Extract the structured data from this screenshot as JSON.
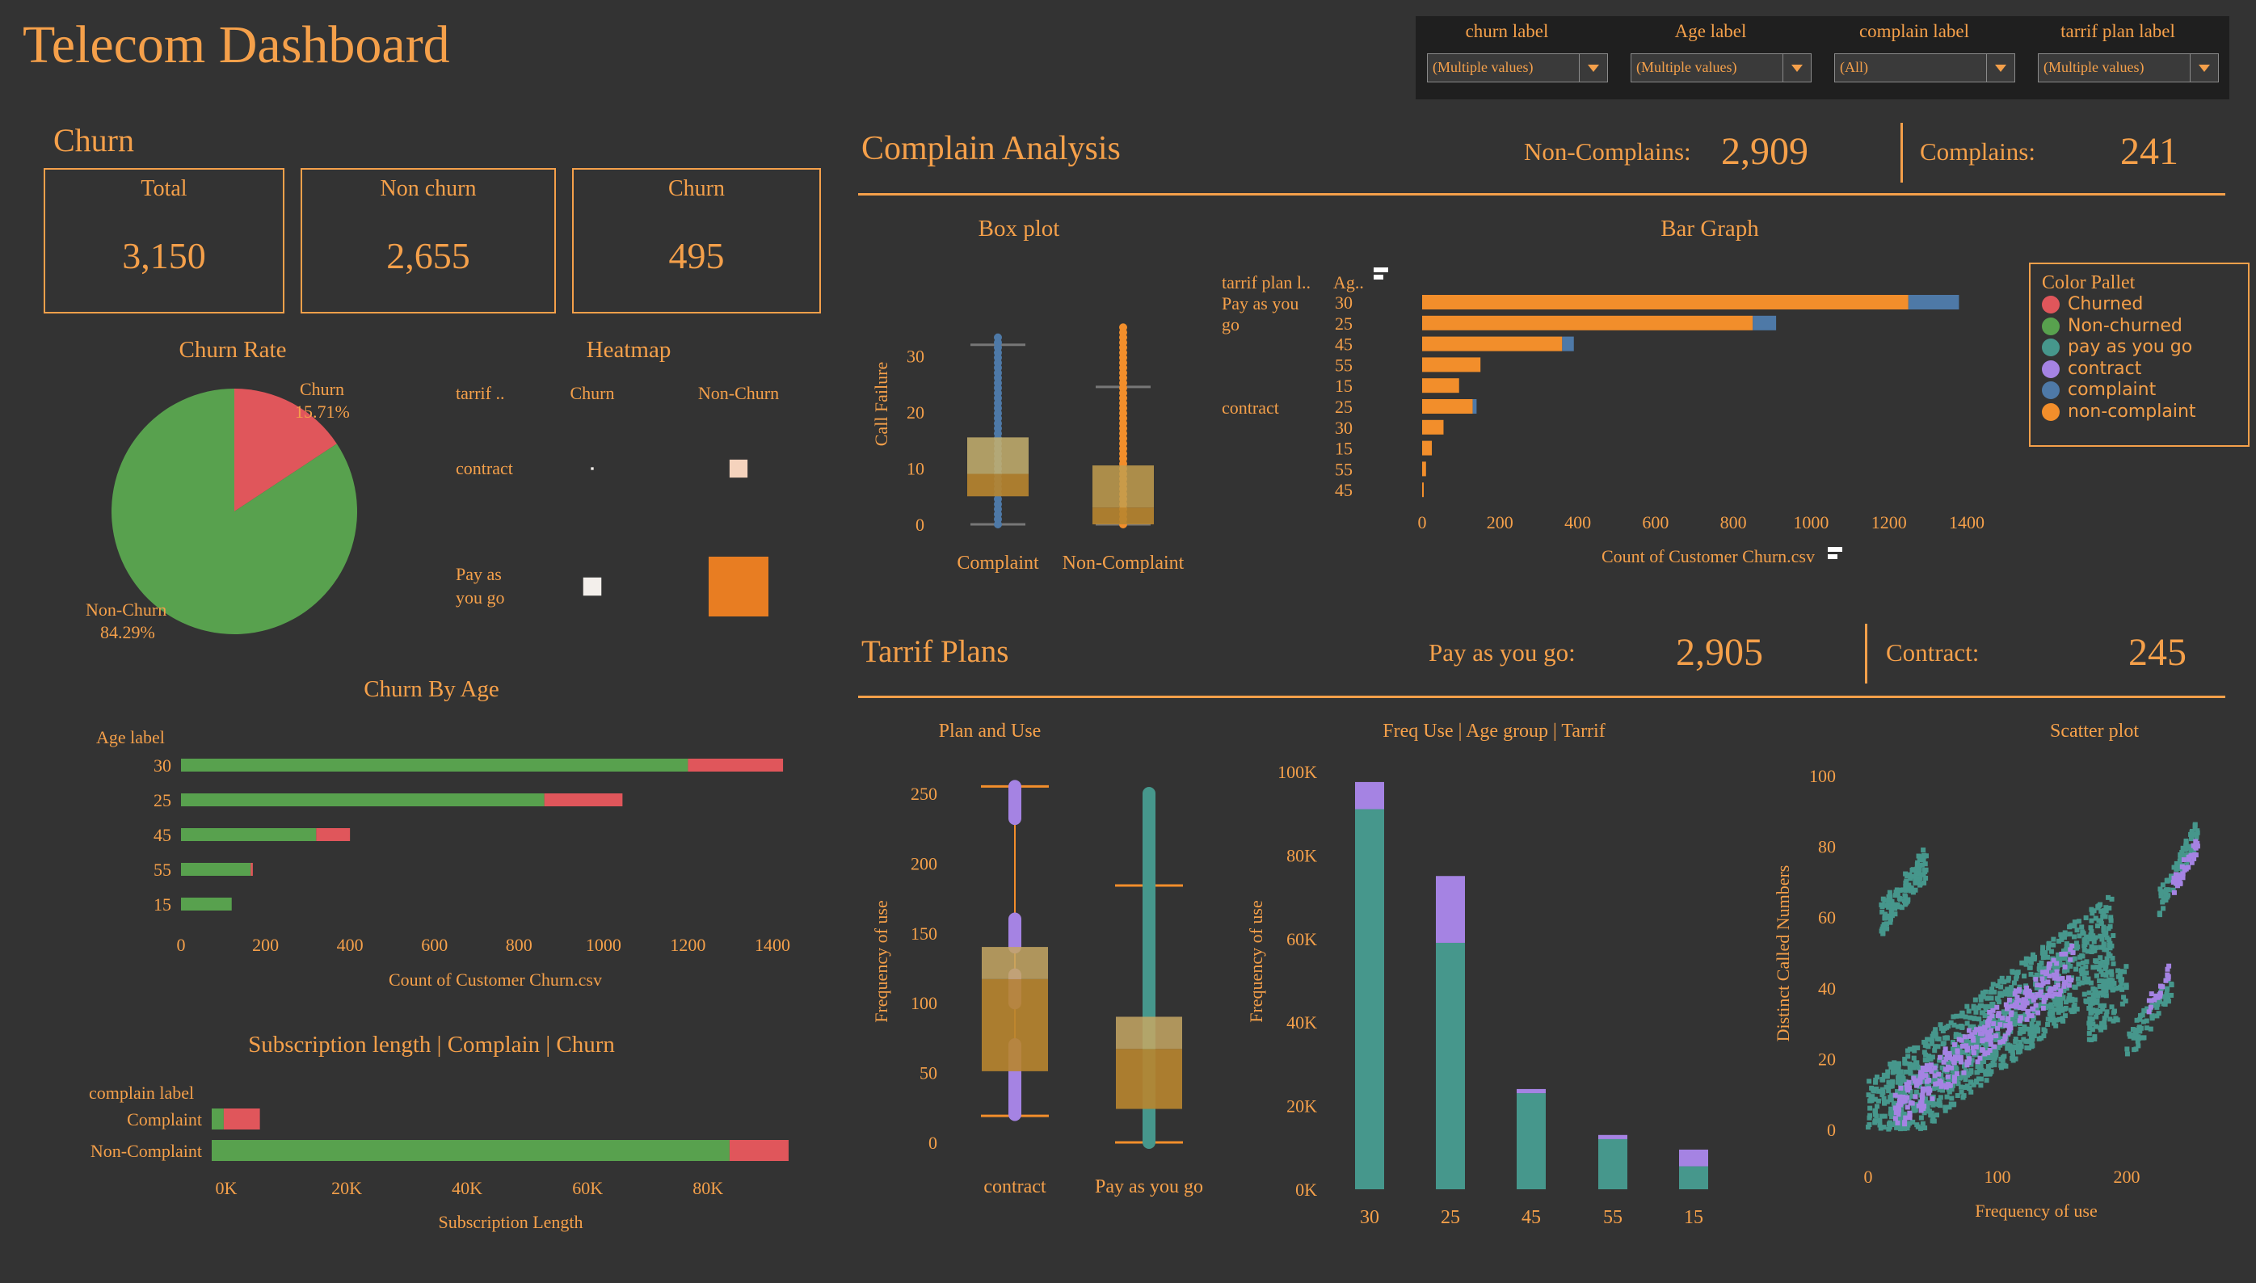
{
  "header": {
    "title": "Telecom Dashboard"
  },
  "filters": [
    {
      "label": "churn label",
      "value": "(Multiple values)"
    },
    {
      "label": "Age label",
      "value": "(Multiple values)"
    },
    {
      "label": "complain label",
      "value": "(All)"
    },
    {
      "label": "tarrif plan label",
      "value": "(Multiple values)"
    }
  ],
  "churn": {
    "title": "Churn",
    "kpis": [
      {
        "label": "Total",
        "value": "3,150"
      },
      {
        "label": "Non churn",
        "value": "2,655"
      },
      {
        "label": "Churn",
        "value": "495"
      }
    ]
  },
  "complain_analysis": {
    "title": "Complain Analysis",
    "non_complains_label": "Non-Complains:",
    "non_complains_value": "2,909",
    "complains_label": "Complains:",
    "complains_value": "241"
  },
  "tarrif_plans": {
    "title": "Tarrif Plans",
    "payg_label": "Pay as you go:",
    "payg_value": "2,905",
    "contract_label": "Contract:",
    "contract_value": "245"
  },
  "color_pallet": {
    "title": "Color Pallet",
    "items": [
      {
        "label": "Churned",
        "color": "#e0565b"
      },
      {
        "label": "Non-churned",
        "color": "#58a14e"
      },
      {
        "label": "pay as you go",
        "color": "#46978c"
      },
      {
        "label": "contract",
        "color": "#a583e3"
      },
      {
        "label": "complaint",
        "color": "#4e79a7"
      },
      {
        "label": "non-complaint",
        "color": "#f28e2b"
      }
    ]
  },
  "colors": {
    "churned": "#e0565b",
    "non_churned": "#58a14e",
    "payg": "#46978c",
    "contract": "#a583e3",
    "complaint": "#4e79a7",
    "non_complaint": "#f28e2b",
    "text": "#f5a04a",
    "background": "#333333"
  },
  "chart_data": [
    {
      "id": "churn-rate",
      "type": "pie",
      "title": "Churn Rate",
      "slices": [
        {
          "name": "Churn",
          "value": 15.71,
          "label": "15.71%",
          "color": "#e0565b"
        },
        {
          "name": "Non-Churn",
          "value": 84.29,
          "label": "84.29%",
          "color": "#58a14e"
        }
      ]
    },
    {
      "id": "heatmap",
      "type": "heatmap",
      "title": "Heatmap",
      "row_header": "tarrif ..",
      "columns": [
        "Churn",
        "Non-Churn"
      ],
      "rows": [
        "contract",
        "Pay as you go"
      ],
      "values": [
        [
          5,
          220
        ],
        [
          225,
          2430
        ]
      ],
      "max": 2430
    },
    {
      "id": "churn-by-age",
      "type": "bar",
      "orientation": "horizontal",
      "stacked": true,
      "title": "Churn By Age",
      "row_header": "Age label",
      "categories": [
        "30",
        "25",
        "45",
        "55",
        "15"
      ],
      "series": [
        {
          "name": "Non-churned",
          "color": "#58a14e",
          "values": [
            1200,
            860,
            320,
            165,
            120
          ]
        },
        {
          "name": "Churned",
          "color": "#e0565b",
          "values": [
            225,
            185,
            80,
            5,
            0
          ]
        }
      ],
      "xlim": [
        0,
        1400
      ],
      "xticks": [
        0,
        200,
        400,
        600,
        800,
        1000,
        1200,
        1400
      ],
      "xlabel": "Count of Customer Churn.csv"
    },
    {
      "id": "subscription-length",
      "type": "bar",
      "orientation": "horizontal",
      "stacked": true,
      "title": "Subscription length | Complain | Churn",
      "row_header": "complain label",
      "categories": [
        "Complaint",
        "Non-Complaint"
      ],
      "series": [
        {
          "name": "Non-churned",
          "color": "#58a14e",
          "values": [
            2000,
            86000
          ]
        },
        {
          "name": "Churned",
          "color": "#e0565b",
          "values": [
            6000,
            9800
          ]
        }
      ],
      "xlim": [
        0,
        95000
      ],
      "xticks": [
        0,
        20000,
        40000,
        60000,
        80000
      ],
      "xticklabels": [
        "0K",
        "20K",
        "40K",
        "60K",
        "80K"
      ],
      "xlabel": "Subscription  Length"
    },
    {
      "id": "box-plot",
      "type": "box",
      "title": "Box plot",
      "ylabel": "Call  Failure",
      "ylim": [
        0,
        36
      ],
      "yticks": [
        0,
        10,
        20,
        30
      ],
      "groups": [
        {
          "name": "Complaint",
          "color": "#4e79a7",
          "min": 0,
          "q1": 5,
          "median": 9,
          "q3": 15.5,
          "max": 32,
          "point_max": 34
        },
        {
          "name": "Non-Complaint",
          "color": "#f28e2b",
          "min": 0,
          "q1": 0,
          "median": 3,
          "q3": 10.5,
          "max": 24.5,
          "point_max": 35.5
        }
      ]
    },
    {
      "id": "bar-graph",
      "type": "bar",
      "orientation": "horizontal",
      "stacked": true,
      "title": "Bar Graph",
      "row_headers": [
        "tarrif plan l..",
        "Ag.."
      ],
      "groups": [
        {
          "name": "Pay as you go",
          "rows": [
            "30",
            "25",
            "45",
            "55",
            "15"
          ]
        },
        {
          "name": "contract",
          "rows": [
            "25",
            "30",
            "15",
            "55",
            "45"
          ]
        }
      ],
      "series": [
        {
          "name": "non-complaint",
          "color": "#f28e2b",
          "values": [
            1250,
            850,
            360,
            150,
            95,
            130,
            55,
            25,
            10,
            3
          ]
        },
        {
          "name": "complaint",
          "color": "#4e79a7",
          "values": [
            130,
            60,
            30,
            0,
            0,
            10,
            0,
            0,
            0,
            0
          ]
        }
      ],
      "xlim": [
        0,
        1400
      ],
      "xticks": [
        0,
        200,
        400,
        600,
        800,
        1000,
        1200,
        1400
      ],
      "xlabel": "Count of Customer Churn.csv"
    },
    {
      "id": "plan-and-use",
      "type": "box",
      "title": "Plan and Use",
      "ylabel": "Frequency of use",
      "ylim": [
        0,
        260
      ],
      "yticks": [
        0,
        50,
        100,
        150,
        200,
        250
      ],
      "groups": [
        {
          "name": "contract",
          "color": "#a583e3",
          "min": 19,
          "q1": 51,
          "median": 117,
          "q3": 140,
          "max": 255
        },
        {
          "name": "Pay as you go",
          "color": "#46978c",
          "min": 0,
          "q1": 24,
          "median": 67,
          "q3": 90,
          "max": 184,
          "point_max": 250
        }
      ]
    },
    {
      "id": "freq-use",
      "type": "bar",
      "stacked": true,
      "title": "Freq Use | Age group | Tarrif",
      "ylabel": "Frequency of use",
      "categories": [
        "30",
        "25",
        "45",
        "55",
        "15"
      ],
      "series": [
        {
          "name": "pay as you go",
          "color": "#46978c",
          "values": [
            91000,
            59000,
            23000,
            12000,
            5500
          ]
        },
        {
          "name": "contract",
          "color": "#a583e3",
          "values": [
            6500,
            16000,
            1000,
            1000,
            4000
          ]
        }
      ],
      "ylim": [
        0,
        100000
      ],
      "yticks": [
        0,
        20000,
        40000,
        60000,
        80000,
        100000
      ],
      "yticklabels": [
        "0K",
        "20K",
        "40K",
        "60K",
        "80K",
        "100K"
      ]
    },
    {
      "id": "scatter",
      "type": "scatter",
      "title": "Scatter plot",
      "xlabel": "Frequency of use",
      "ylabel": "Distinct Called Numbers",
      "xlim": [
        0,
        255
      ],
      "ylim": [
        0,
        100
      ],
      "xticks": [
        0,
        100,
        200
      ],
      "yticks": [
        0,
        20,
        40,
        60,
        80,
        100
      ],
      "series": [
        {
          "name": "pay as you go",
          "color": "#46978c"
        },
        {
          "name": "contract",
          "color": "#a583e3"
        }
      ]
    }
  ],
  "labels": {
    "complaint": "Complaint",
    "non_complaint": "Non-Complaint",
    "contract": "contract",
    "pay_as_you_go": "Pay as you go",
    "pay_as_you_go_wrapped_1": "Pay as you",
    "pay_as_you_go_wrapped_2": "go",
    "pay_as_you_go_hm_1": "Pay as",
    "pay_as_you_go_hm_2": "you go",
    "churn_slice": "Churn",
    "non_churn_slice": "Non-Churn"
  }
}
